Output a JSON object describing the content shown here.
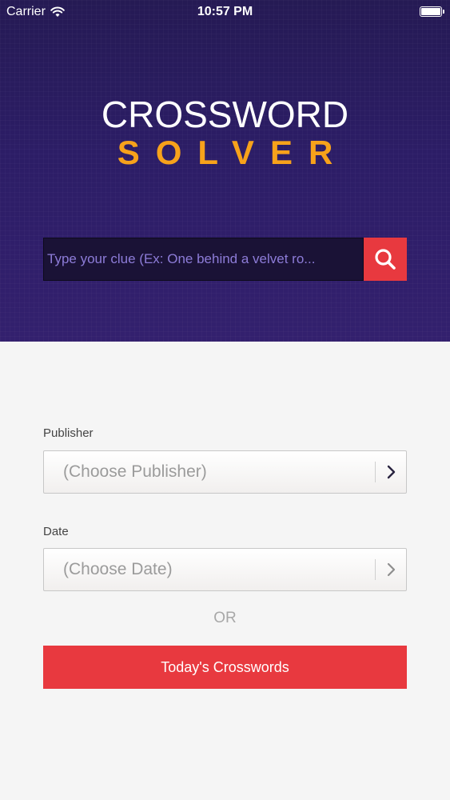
{
  "status_bar": {
    "carrier": "Carrier",
    "time": "10:57 PM"
  },
  "logo": {
    "line1": "CROSSWORD",
    "line2": "SOLVER"
  },
  "search": {
    "placeholder": "Type your clue (Ex: One behind a velvet ro..."
  },
  "publisher": {
    "label": "Publisher",
    "value": "(Choose Publisher)"
  },
  "date": {
    "label": "Date",
    "value": "(Choose Date)"
  },
  "or_text": "OR",
  "today_button": "Today's Crosswords",
  "colors": {
    "hero_bg": "#2c1d66",
    "accent_red": "#e8393f",
    "logo_orange": "#f7a21b"
  },
  "icons": {
    "search": "search-icon",
    "chevron": "chevron-right-icon",
    "wifi": "wifi-icon",
    "battery": "battery-icon"
  }
}
